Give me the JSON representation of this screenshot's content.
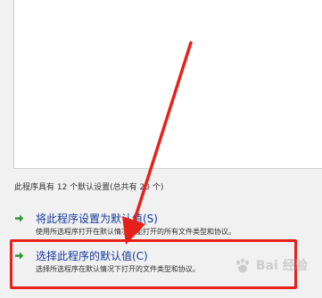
{
  "summary_text": "此程序具有 12 个默认设置(总共有 20 个)",
  "options": [
    {
      "title": "将此程序设置为默认值(S)",
      "description": "使用所选程序打开在默认情况下能打开的所有文件类型和协议。",
      "icon": "green-arrow-icon"
    },
    {
      "title": "选择此程序的默认值(C)",
      "description": "选择所选程序在默认情况下打开的文件类型和协议。",
      "icon": "green-arrow-icon"
    }
  ],
  "watermark": {
    "text": "Bai 经验",
    "icon": "baidu-paw-icon"
  },
  "colors": {
    "link_title": "#153a9e",
    "arrow": "#2c9a2c",
    "annotation_red": "#e8201b",
    "panel_bg": "#ffffff",
    "window_bg": "#f1f1f1"
  }
}
